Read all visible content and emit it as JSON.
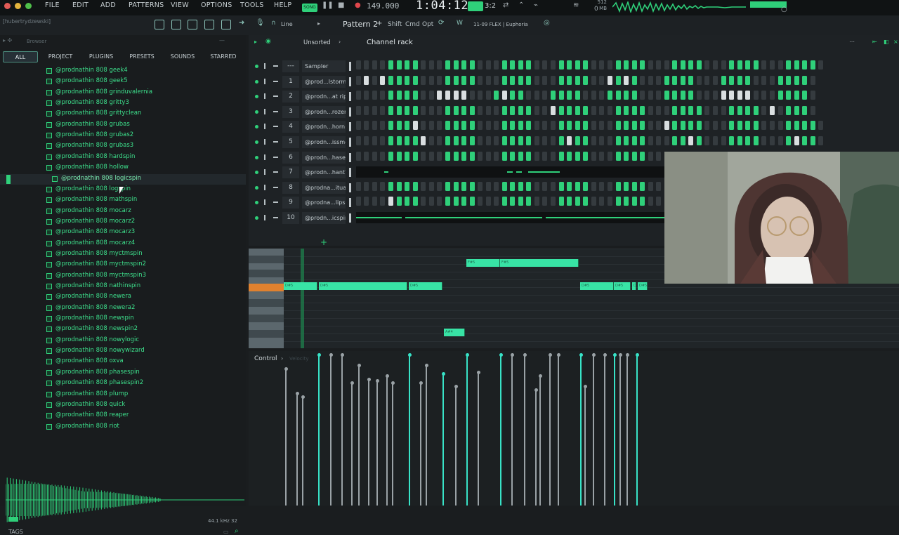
{
  "menu": {
    "items": [
      "FILE",
      "EDIT",
      "ADD",
      "PATTERNS",
      "VIEW",
      "OPTIONS",
      "TOOLS",
      "HELP"
    ],
    "mode_badge": "SONG"
  },
  "transport": {
    "tempo": "149.000",
    "time": "1:04:12",
    "beat": "3:2",
    "memory": "512 MB",
    "cpu": "0"
  },
  "toolbar": {
    "user": "[hubertrydzewski]",
    "snap": "Line",
    "pattern": "Pattern 2",
    "shift": "Shift",
    "cmd": "Cmd",
    "opt": "Opt",
    "flex": "11-09  FLEX | Euphoria"
  },
  "browser": {
    "title": "Browser",
    "tabs": [
      "ALL",
      "PROJECT",
      "PLUGINS",
      "PRESETS",
      "SOUNDS",
      "STARRED"
    ],
    "files": [
      "@prodnathin 808 geek4",
      "@prodnathin 808 geek5",
      "@prodnathin 808 grinduvalernia",
      "@prodnathin 808 gritty3",
      "@prodnathin 808 grittyclean",
      "@prodnathin 808 grubas",
      "@prodnathin 808 grubas2",
      "@prodnathin 808 grubas3",
      "@prodnathin 808 hardspin",
      "@prodnathin 808 hollow",
      "@prodnathin 808 logicspin",
      "@prodnathin 808 logspin",
      "@prodnathin 808 mathspin",
      "@prodnathin 808 mocarz",
      "@prodnathin 808 mocarz2",
      "@prodnathin 808 mocarz3",
      "@prodnathin 808 mocarz4",
      "@prodnathin 808 myctmspin",
      "@prodnathin 808 myctmspin2",
      "@prodnathin 808 myctmspin3",
      "@prodnathin 808 nathinspin",
      "@prodnathin 808 newera",
      "@prodnathin 808 newera2",
      "@prodnathin 808 newspin",
      "@prodnathin 808 newspin2",
      "@prodnathin 808 nowylogic",
      "@prodnathin 808 nowywizard",
      "@prodnathin 808 oxva",
      "@prodnathin 808 phasespin",
      "@prodnathin 808 phasespin2",
      "@prodnathin 808 plump",
      "@prodnathin 808 quick",
      "@prodnathin 808 reaper",
      "@prodnathin 808 riot"
    ],
    "selected_index": 10,
    "sample_info": "44.1 kHz 32",
    "tags_label": "TAGS"
  },
  "channel_rack": {
    "sort": "Unsorted",
    "title": "Channel rack",
    "channels": [
      {
        "num": "---",
        "name": "Sampler",
        "pattern": "0000111100011110001111000111100011110001111000111100011110"
      },
      {
        "num": "1",
        "name": "@prod...lstorm",
        "pattern": "0W0W111100011110001111000111100W1W10001111000111100011110"
      },
      {
        "num": "2",
        "name": "@prodn...at rip",
        "pattern": "0000111100WWWW0001W11000111100011110001111000WWWW00011110"
      },
      {
        "num": "3",
        "name": "@prodn...rozen",
        "pattern": "000011110001111000111100W11110001111000111100011110W01110"
      },
      {
        "num": "4",
        "name": "@prodn...horn",
        "pattern": "0000111W000111100011110001111000111100W1111000111100011110"
      },
      {
        "num": "5",
        "name": "@prodn...issme",
        "pattern": "00001111W00111100011110001W11000111100011W100011110001W110"
      },
      {
        "num": "6",
        "name": "@prodn...hased",
        "pattern": "0000111100011110001111000111100011110001111000111100011110"
      },
      {
        "num": "7",
        "name": "@prodn...hant7",
        "pattern": "lane"
      },
      {
        "num": "8",
        "name": "@prodna...itual",
        "pattern": "000011110001111000111100011110001111000W111000111100011110"
      },
      {
        "num": "9",
        "name": "@prodna...lipse",
        "pattern": "0000W11100011110001111000111100011110001W11000111100011110"
      },
      {
        "num": "10",
        "name": "@prodn...icspin",
        "pattern": "lane"
      }
    ]
  },
  "piano_roll": {
    "notes": [
      {
        "label": "F#5",
        "row": 1
      },
      {
        "label": "F#5",
        "row": 1
      },
      {
        "label": "D#5",
        "row": 4
      },
      {
        "label": "D#5",
        "row": 4
      },
      {
        "label": "D#5",
        "row": 4
      },
      {
        "label": "D#5",
        "row": 4
      },
      {
        "label": "D#5",
        "row": 4
      },
      {
        "label": "D#5",
        "row": 4
      },
      {
        "label": "D#5",
        "row": 4
      },
      {
        "label": "A#4",
        "row": 10
      }
    ]
  },
  "control": {
    "label": "Control",
    "sub": "Velocity"
  }
}
